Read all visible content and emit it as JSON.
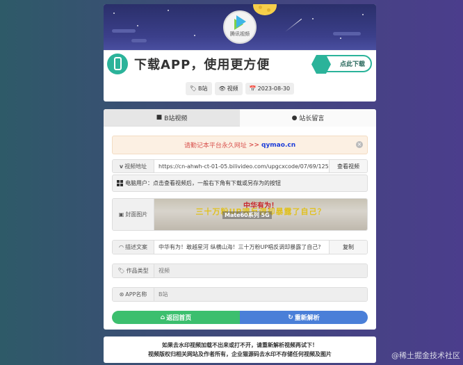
{
  "header": {
    "logo_text": "腾讯视频",
    "banner_text": "下载APP，使用更方便",
    "download_button": "点此下载",
    "meta": {
      "category": "B站",
      "type": "视频",
      "date": "2023-08-30"
    }
  },
  "tabs": [
    {
      "label": "B站视频",
      "icon": "video-icon",
      "active": true
    },
    {
      "label": "站长留言",
      "icon": "comment-icon",
      "active": false
    }
  ],
  "notice": {
    "text": "请勤记本平台永久网址",
    "arrows": ">>",
    "domain": "qymao.cn",
    "close": "×"
  },
  "video_url": {
    "label": "视频地址",
    "value": "https://cn-ahwh-ct-01-05.bilivideo.com/upgcxcode/07/69/12516069",
    "action": "查看视频"
  },
  "pc_tip": "电脑用户：点击查看视频后，一般右下角有下载或另存为的按钮",
  "cover": {
    "label": "封面图片",
    "caption_red": "中华有为！",
    "caption_yellow": "三十万粉UP喝反调却暴露了自己？",
    "brand": "Mate60系列 5G"
  },
  "description": {
    "label": "描述文案",
    "value": "中华有为！敢越星河 纵横山海！三十万粉UP唱反调却暴露了自己?",
    "action": "复制"
  },
  "work_type": {
    "label": "作品类型",
    "value": "视频"
  },
  "app_name": {
    "label": "APP名称",
    "value": "B站"
  },
  "buttons": {
    "home": "返回首页",
    "reparse": "重新解析"
  },
  "footer": {
    "line1": "如果去水印视频加载不出来或打不开，请重新解析视频再试下！",
    "line2": "视频版权归相关网站及作者所有，企业猫源码去水印不存储任何视频及图片"
  },
  "watermark": "@稀土掘金技术社区",
  "colors": {
    "accent_teal": "#2bb39a",
    "button_green": "#3cbf6e",
    "button_blue": "#4a7fd8",
    "notice_red": "#d9534f",
    "notice_domain": "#1d3dd9"
  }
}
